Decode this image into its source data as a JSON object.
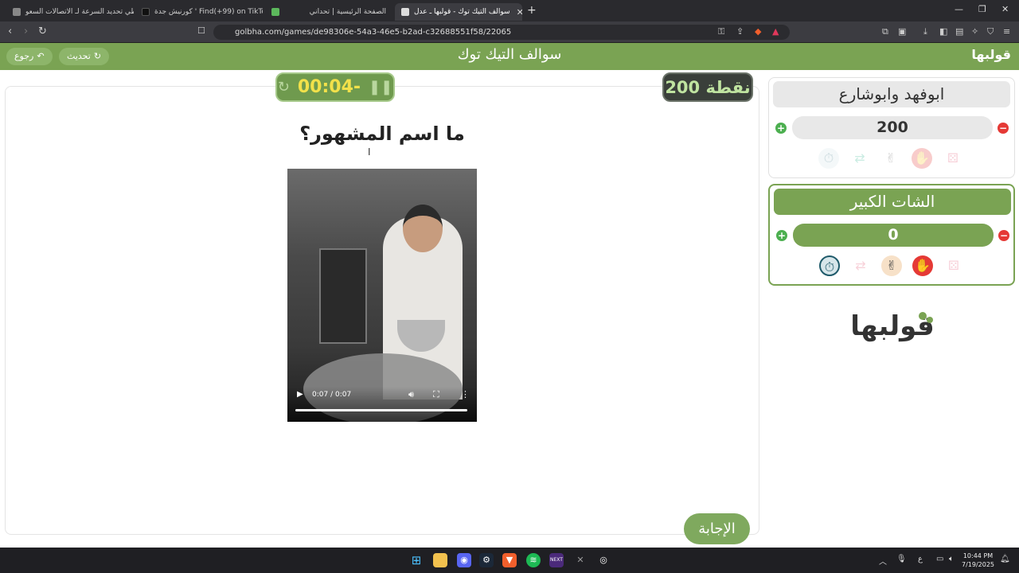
{
  "browser": {
    "tabs": [
      {
        "label": "تخطي تحديد السرعة لـ الاتصالات السعو",
        "color": "#888"
      },
      {
        "label": "كورنيش جدة ' Find(+99) on TikTok | T",
        "color": "#111"
      },
      {
        "label": "الصفحة الرئيسية | تحداني",
        "color": "#5cb85c"
      },
      {
        "label": "سوالف التيك توك - قولبها ـ عدل",
        "color": "#ddd"
      }
    ],
    "url": "golbha.com/games/de98306e-54a3-46e5-b2ad-c32688551f58/22065"
  },
  "header": {
    "title": "سوالف التيك توك",
    "back_label": "رجوع",
    "refresh_label": "تحديث",
    "logo": "قولبها"
  },
  "game": {
    "timer": "00:04-",
    "points": "200 نقطة",
    "question": "ما اسم المشهور؟",
    "answer_label": "الإجابة",
    "video": {
      "time": "0:07 / 0:07",
      "progress": 1.0
    }
  },
  "teams": [
    {
      "name": "ابوفهد وابوشارع",
      "score": "200",
      "active": false
    },
    {
      "name": "الشات الكبير",
      "score": "0",
      "active": true
    }
  ],
  "logo_text": "قولبها",
  "taskbar": {
    "time": "10:44 PM",
    "date": "7/19/2025",
    "lang": "ع"
  },
  "colors": {
    "accent": "#7aa353",
    "timer_text": "#f2e14a",
    "points_bg": "#3a3f3a"
  }
}
